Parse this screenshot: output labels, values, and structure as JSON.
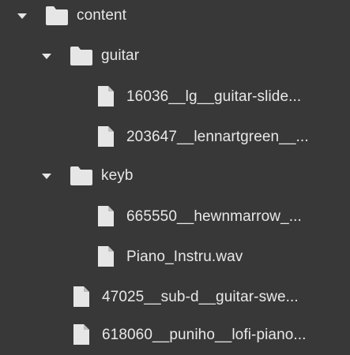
{
  "tree": {
    "root": {
      "label": "content",
      "expanded": true,
      "icon": "folder-icon",
      "children": [
        {
          "label": "guitar",
          "expanded": true,
          "icon": "folder-icon",
          "files": [
            {
              "label": "16036__lg__guitar-slide...",
              "icon": "file-icon"
            },
            {
              "label": "203647__lennartgreen__...",
              "icon": "file-icon"
            }
          ]
        },
        {
          "label": "keyb",
          "expanded": true,
          "icon": "folder-icon",
          "files": [
            {
              "label": "665550__hewnmarrow_...",
              "icon": "file-icon"
            },
            {
              "label": "Piano_Instru.wav",
              "icon": "file-icon"
            }
          ]
        }
      ],
      "files": [
        {
          "label": "47025__sub-d__guitar-swe...",
          "icon": "file-icon"
        },
        {
          "label": "618060__puniho__lofi-piano...",
          "icon": "file-icon"
        }
      ]
    },
    "colors": {
      "background": "#383838",
      "icon": "#e6e6e6",
      "text": "#e8e8e8"
    }
  }
}
